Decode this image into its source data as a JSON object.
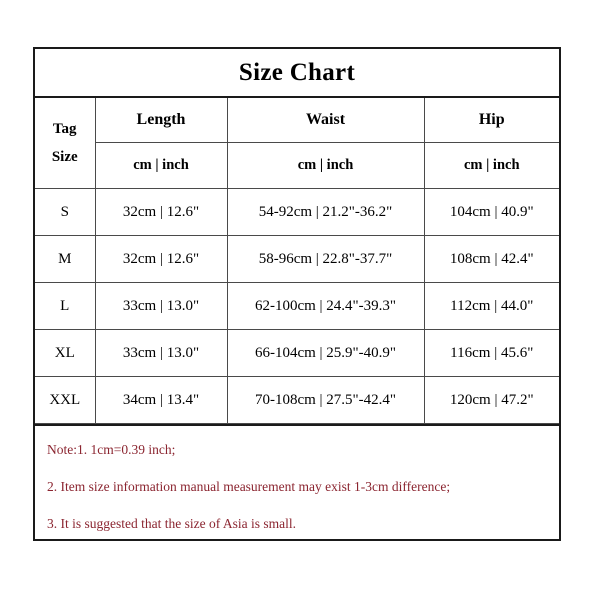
{
  "document": {
    "title": "Size Chart"
  },
  "table": {
    "tag_header": {
      "line1": "Tag",
      "line2": "Size"
    },
    "group_headers": [
      "Length",
      "Waist",
      "Hip"
    ],
    "unit_headers": [
      "cm | inch",
      "cm | inch",
      "cm | inch"
    ],
    "rows": [
      {
        "size": "S",
        "length": "32cm | 12.6\"",
        "waist": "54-92cm | 21.2\"-36.2\"",
        "hip": "104cm | 40.9\""
      },
      {
        "size": "M",
        "length": "32cm | 12.6\"",
        "waist": "58-96cm | 22.8\"-37.7\"",
        "hip": "108cm | 42.4\""
      },
      {
        "size": "L",
        "length": "33cm | 13.0\"",
        "waist": "62-100cm | 24.4\"-39.3\"",
        "hip": "112cm | 44.0\""
      },
      {
        "size": "XL",
        "length": "33cm | 13.0\"",
        "waist": "66-104cm | 25.9\"-40.9\"",
        "hip": "116cm | 45.6\""
      },
      {
        "size": "XXL",
        "length": "34cm | 13.4\"",
        "waist": "70-108cm | 27.5\"-42.4\"",
        "hip": "120cm | 47.2\""
      }
    ]
  },
  "notes": {
    "lines": [
      "Note:1.    1cm=0.39 inch;",
      "2.  Item size information manual measurement may exist 1-3cm difference;",
      "3.  It is suggested that the size of Asia is small."
    ],
    "color": "#8B2530"
  },
  "colors": {
    "background": "#ffffff",
    "text": "#000000",
    "border_outer": "#1a1a1a",
    "border_inner": "#4a4a4a",
    "note_text": "#8B2530"
  }
}
